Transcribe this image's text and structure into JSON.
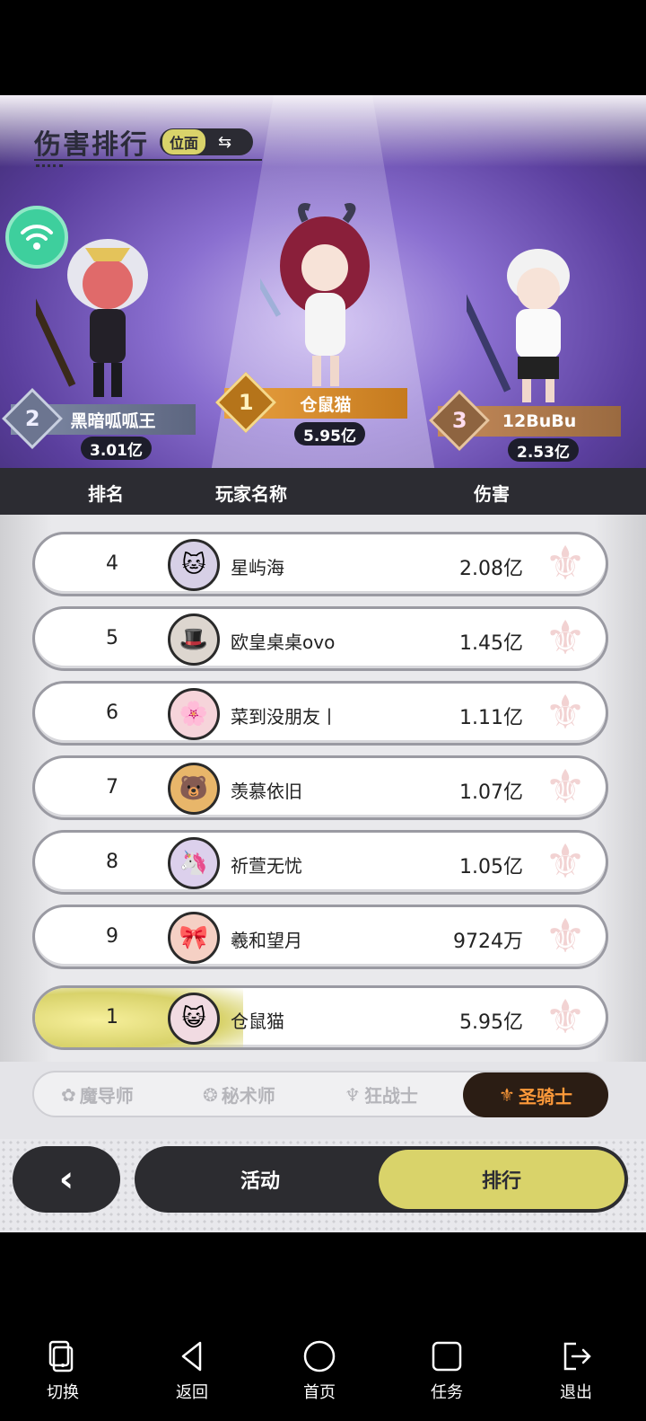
{
  "header": {
    "title": "伤害排行",
    "scope_tag": "位面",
    "swap_icon": "swap-arrows-icon"
  },
  "podium": [
    {
      "rank": "2",
      "name": "黑暗呱呱王",
      "damage": "3.01亿"
    },
    {
      "rank": "1",
      "name": "仓鼠猫",
      "damage": "5.95亿"
    },
    {
      "rank": "3",
      "name": "12BuBu",
      "damage": "2.53亿"
    }
  ],
  "table_header": {
    "rank": "排名",
    "player": "玩家名称",
    "damage": "伤害"
  },
  "rows": [
    {
      "rank": "4",
      "name": "星屿海",
      "damage": "2.08亿"
    },
    {
      "rank": "5",
      "name": "欧皇桌桌ovo",
      "damage": "1.45亿"
    },
    {
      "rank": "6",
      "name": "菜到没朋友丨",
      "damage": "1.11亿"
    },
    {
      "rank": "7",
      "name": "羡慕依旧",
      "damage": "1.07亿"
    },
    {
      "rank": "8",
      "name": "祈萱无忧",
      "damage": "1.05亿"
    },
    {
      "rank": "9",
      "name": "羲和望月",
      "damage": "9724万"
    }
  ],
  "my_row": {
    "rank": "1",
    "name": "仓鼠猫",
    "damage": "5.95亿"
  },
  "class_tabs": [
    {
      "label": "魔导师",
      "active": false
    },
    {
      "label": "秘术师",
      "active": false
    },
    {
      "label": "狂战士",
      "active": false
    },
    {
      "label": "圣骑士",
      "active": true
    }
  ],
  "bottom": {
    "activity": "活动",
    "ranking": "排行"
  },
  "system_nav": [
    {
      "label": "切换",
      "icon": "switch-icon"
    },
    {
      "label": "返回",
      "icon": "back-icon"
    },
    {
      "label": "首页",
      "icon": "home-icon"
    },
    {
      "label": "任务",
      "icon": "tasks-icon"
    },
    {
      "label": "退出",
      "icon": "exit-icon"
    }
  ],
  "colors": {
    "accent_yellow": "#d9d36a",
    "dark": "#2c2c30",
    "paladin_orange": "#ff9a3a"
  }
}
